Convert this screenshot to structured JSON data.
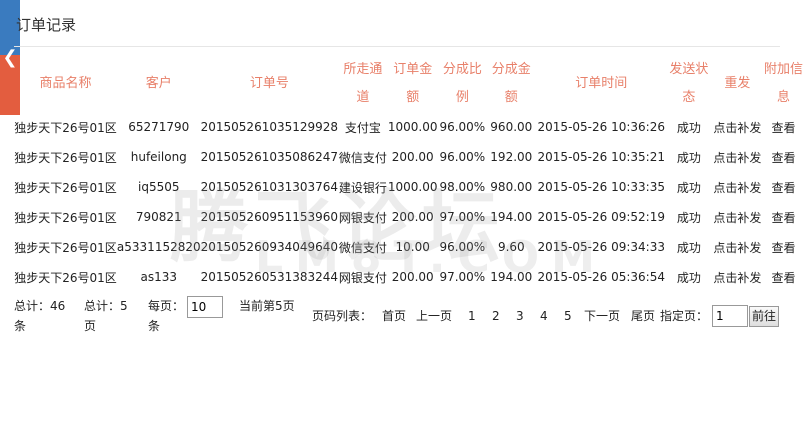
{
  "panel": {
    "title": "订单记录",
    "collapse_glyph": "❮"
  },
  "table": {
    "headers": [
      "商品名称",
      "客户",
      "订单号",
      "所走通道",
      "订单金额",
      "分成比例",
      "分成金额",
      "订单时间",
      "发送状态",
      "重发",
      "附加信息"
    ],
    "rows": [
      [
        "独步天下26号01区",
        "65271790",
        "201505261035129928",
        "支付宝",
        "1000.00",
        "96.00%",
        "960.00",
        "2015-05-26 10:36:26",
        "成功",
        "点击补发",
        "查看"
      ],
      [
        "独步天下26号01区",
        "hufeilong",
        "201505261035086247",
        "微信支付",
        "200.00",
        "96.00%",
        "192.00",
        "2015-05-26 10:35:21",
        "成功",
        "点击补发",
        "查看"
      ],
      [
        "独步天下26号01区",
        "iq5505",
        "201505261031303764",
        "建设银行",
        "1000.00",
        "98.00%",
        "980.00",
        "2015-05-26 10:33:35",
        "成功",
        "点击补发",
        "查看"
      ],
      [
        "独步天下26号01区",
        "790821",
        "201505260951153960",
        "网银支付",
        "200.00",
        "97.00%",
        "194.00",
        "2015-05-26 09:52:19",
        "成功",
        "点击补发",
        "查看"
      ],
      [
        "独步天下26号01区",
        "a5331152820",
        "201505260934049640",
        "微信支付",
        "10.00",
        "96.00%",
        "9.60",
        "2015-05-26 09:34:33",
        "成功",
        "点击补发",
        "查看"
      ],
      [
        "独步天下26号01区",
        "as133",
        "201505260531383244",
        "网银支付",
        "200.00",
        "97.00%",
        "194.00",
        "2015-05-26 05:36:54",
        "成功",
        "点击补发",
        "查看"
      ]
    ]
  },
  "footer": {
    "total_records": "总计：46条",
    "total_pages": "总计：5页",
    "per_page_label": "每页：",
    "per_page_value": "10",
    "per_page_unit": "条",
    "current_page": "当前第5页",
    "page_list_label": "页码列表：",
    "first": "首页",
    "prev": "上一页",
    "pages": [
      "1",
      "2",
      "3",
      "4",
      "5"
    ],
    "next": "下一页",
    "last": "尾页",
    "goto_label": "指定页：",
    "goto_value": "1",
    "goto_button": "前往"
  },
  "watermark": {
    "text": "腾飞论坛",
    "sub": "LM8T.COM"
  },
  "colors": {
    "header_text": "#e8806a",
    "success": "#2a8a2a",
    "action_link": "#1b2a8a",
    "side_blue": "#3a7bbf",
    "side_red": "#e35d3f"
  }
}
